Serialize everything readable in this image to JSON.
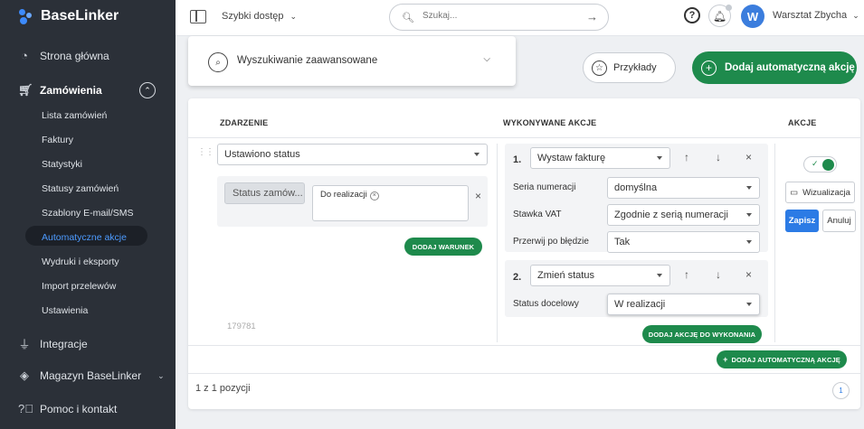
{
  "app": {
    "name": "BaseLinker"
  },
  "sidebar": {
    "main_items": [
      {
        "label": "Strona główna",
        "icon": "speedometer-icon"
      },
      {
        "label": "Zamówienia",
        "icon": "cart-icon"
      },
      {
        "label": "Integracje",
        "icon": "plug-icon"
      },
      {
        "label": "Magazyn BaseLinker",
        "icon": "box-icon"
      },
      {
        "label": "Pomoc i kontakt",
        "icon": "help-icon"
      }
    ],
    "sub_items": [
      {
        "label": "Lista zamówień"
      },
      {
        "label": "Faktury"
      },
      {
        "label": "Statystyki"
      },
      {
        "label": "Statusy zamówień"
      },
      {
        "label": "Szablony E-mail/SMS"
      },
      {
        "label": "Automatyczne akcje",
        "active": true
      },
      {
        "label": "Wydruki i eksporty"
      },
      {
        "label": "Import przelewów"
      },
      {
        "label": "Ustawienia"
      }
    ]
  },
  "topbar": {
    "quick_access": "Szybki dostęp",
    "search_placeholder": "Szukaj...",
    "user_initial": "W",
    "user_name": "Warsztat Zbycha"
  },
  "toolbar": {
    "advanced_search": "Wyszukiwanie zaawansowane",
    "examples": "Przykłady",
    "add_automatic_action": "Dodaj automatyczną akcję"
  },
  "table": {
    "headers": {
      "event": "ZDARZENIE",
      "actions_performed": "WYKONYWANE AKCJE",
      "actions": "AKCJE"
    },
    "event": {
      "trigger": "Ustawiono status",
      "condition_field": "Status zamów...",
      "condition_value": "Do realizacji",
      "add_condition": "DODAJ WARUNEK",
      "id": "179781"
    },
    "steps": [
      {
        "number": "1.",
        "action": "Wystaw fakturę",
        "fields": [
          {
            "label": "Seria numeracji",
            "value": "domyślna"
          },
          {
            "label": "Stawka VAT",
            "value": "Zgodnie z serią numeracji"
          },
          {
            "label": "Przerwij po błędzie",
            "value": "Tak"
          }
        ]
      },
      {
        "number": "2.",
        "action": "Zmień status",
        "fields": [
          {
            "label": "Status docelowy",
            "value": "W realizacji"
          }
        ]
      }
    ],
    "add_action": "DODAJ AKCJĘ DO WYKONANIA",
    "row_actions": {
      "visualize": "Wizualizacja",
      "save": "Zapisz",
      "cancel": "Anuluj",
      "enabled": true
    }
  },
  "footer": {
    "add_automatic_action": "DODAJ AUTOMATYCZNĄ AKCJĘ",
    "pagination_text": "1 z 1 pozycji",
    "current_page": "1"
  },
  "colors": {
    "sidebar": "#2b3038",
    "accent_green": "#1e8a4c",
    "primary_blue": "#2c7be5",
    "avatar": "#3b7ddd"
  }
}
